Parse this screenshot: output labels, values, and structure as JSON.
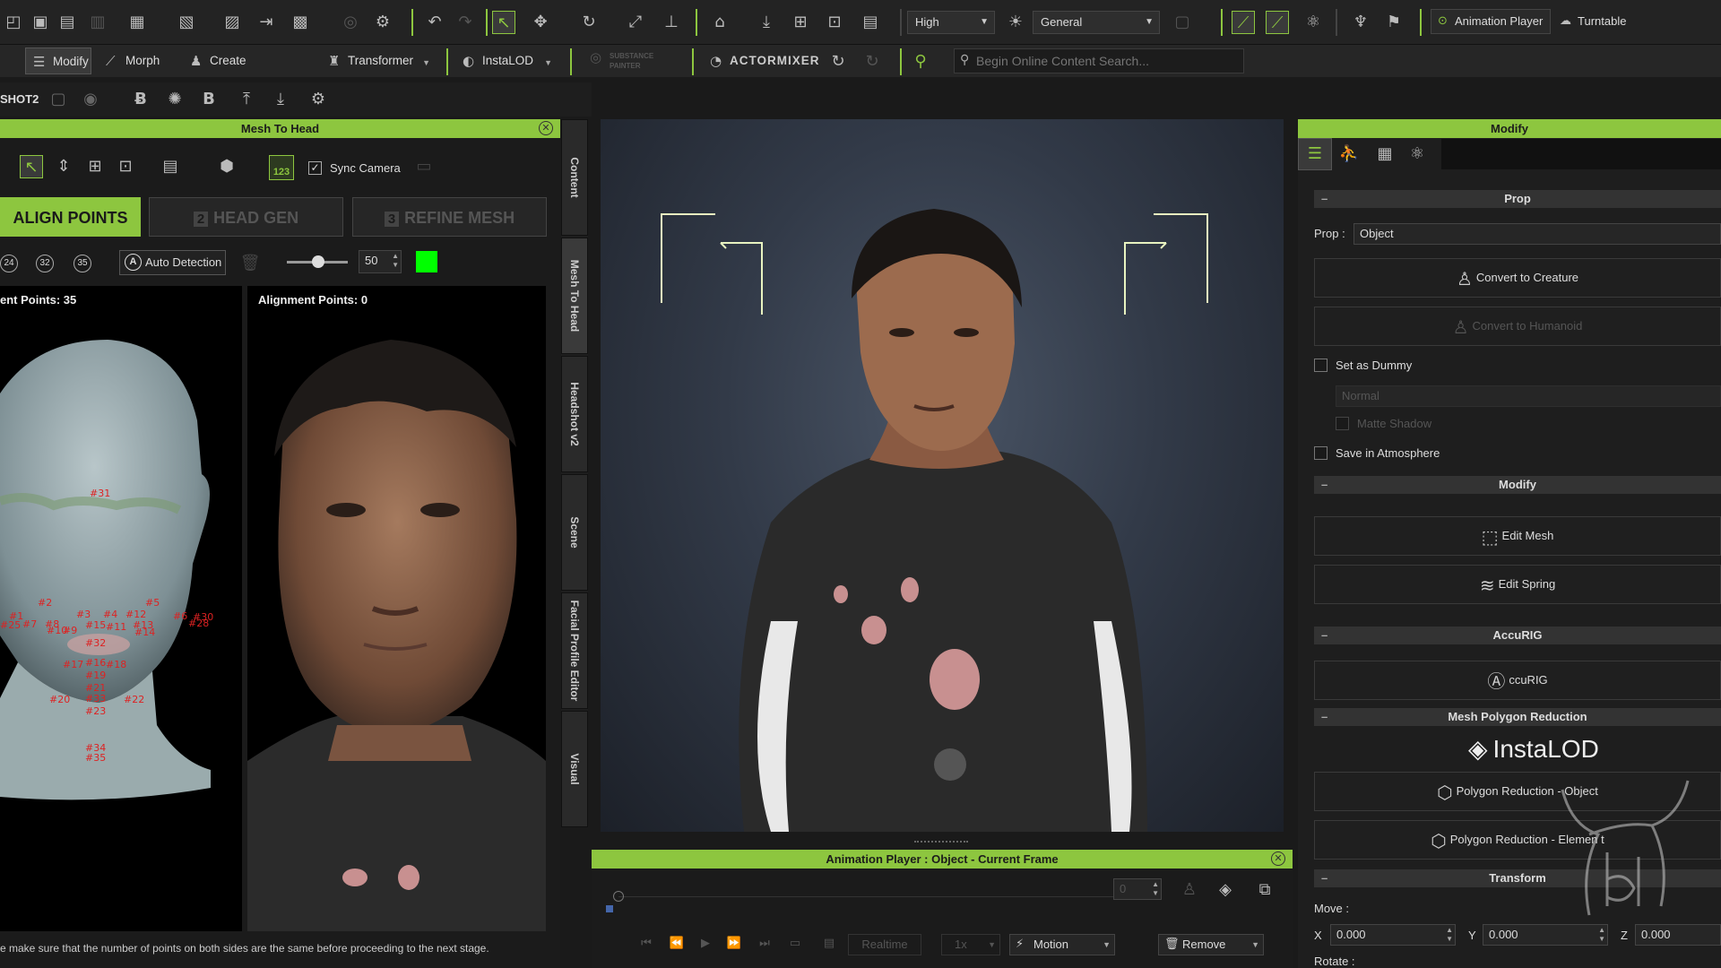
{
  "toolbar1": {
    "quality_value": "High",
    "mode_value": "General",
    "animation_player_label": "Animation Player",
    "turntable_label": "Turntable"
  },
  "toolbar2": {
    "modify_label": "Modify",
    "morph_label": "Morph",
    "create_character_label": "Create Character",
    "transformer_label": "Transformer",
    "instalod_label": "InstaLOD",
    "substance_label": "SUBSTANCE PAINTER",
    "actormixer_label": "ACTORMIXER",
    "search_placeholder": "Begin Online Content Search..."
  },
  "toolbar3": {
    "headshot_label": "SHOT2"
  },
  "mesh_to_head": {
    "title": "Mesh To Head",
    "sync_camera_label": "Sync Camera",
    "counter_badge": "123",
    "align_points_label": "ALIGN POINTS",
    "head_gen_label": "HEAD GEN",
    "head_gen_num": "2",
    "refine_mesh_label": "REFINE MESH",
    "refine_mesh_num": "3",
    "preset_24": "24",
    "preset_32": "32",
    "preset_35": "35",
    "auto_detection_label": "Auto Detection",
    "slider_value": "50",
    "left_points_label": "ent Points: 35",
    "right_points_label": "Alignment Points: 0",
    "footer_text": "e make sure that the number of points on both sides are the same before proceeding to the next stage.",
    "markers": [
      "#31",
      "#2",
      "#5",
      "#1",
      "#6",
      "#30",
      "#7",
      "#8",
      "#3",
      "#4",
      "#12",
      "#28",
      "#25",
      "#10",
      "#9",
      "#15",
      "#11",
      "#13",
      "#14",
      "#32",
      "#17",
      "#16",
      "#18",
      "#19",
      "#21",
      "#20",
      "#33",
      "#22",
      "#23",
      "#34",
      "#35"
    ]
  },
  "vertical_tabs": [
    "Content",
    "Mesh To Head",
    "Headshot v2",
    "Scene",
    "Facial Profile Editor",
    "Visual"
  ],
  "animation_player": {
    "title": "Animation Player : Object - Current Frame",
    "frame_value": "0",
    "realtime_label": "Realtime",
    "speed_value": "1x",
    "motion_label": "Motion",
    "remove_label": "Remove"
  },
  "modify_panel": {
    "title": "Modify",
    "prop_section": "Prop",
    "prop_label": "Prop :",
    "prop_value": "Object",
    "convert_creature_label": "Convert to Creature",
    "convert_humanoid_label": "Convert to Humanoid",
    "set_dummy_label": "Set as Dummy",
    "normal_value": "Normal",
    "matte_shadow_label": "Matte Shadow",
    "save_atmosphere_label": "Save in Atmosphere",
    "modify_section": "Modify",
    "edit_mesh_label": "Edit Mesh",
    "edit_spring_label": "Edit Spring",
    "accurig_section": "AccuRIG",
    "accurig_label": "ccuRIG",
    "mesh_poly_section": "Mesh Polygon Reduction",
    "instalod_logo": "InstaLOD",
    "poly_object_label": "Polygon Reduction - Object",
    "poly_element_label": "Polygon Reduction - Elemen t",
    "transform_section": "Transform",
    "move_label": "Move :",
    "x_label": "X",
    "x_value": "0.000",
    "y_label": "Y",
    "y_value": "0.000",
    "z_label": "Z",
    "z_value": "0.000",
    "rotate_label": "Rotate :"
  },
  "colors": {
    "accent_green": "#8dc63f",
    "marker_red": "#dd2222",
    "bright_green_swatch": "#00ff00"
  }
}
